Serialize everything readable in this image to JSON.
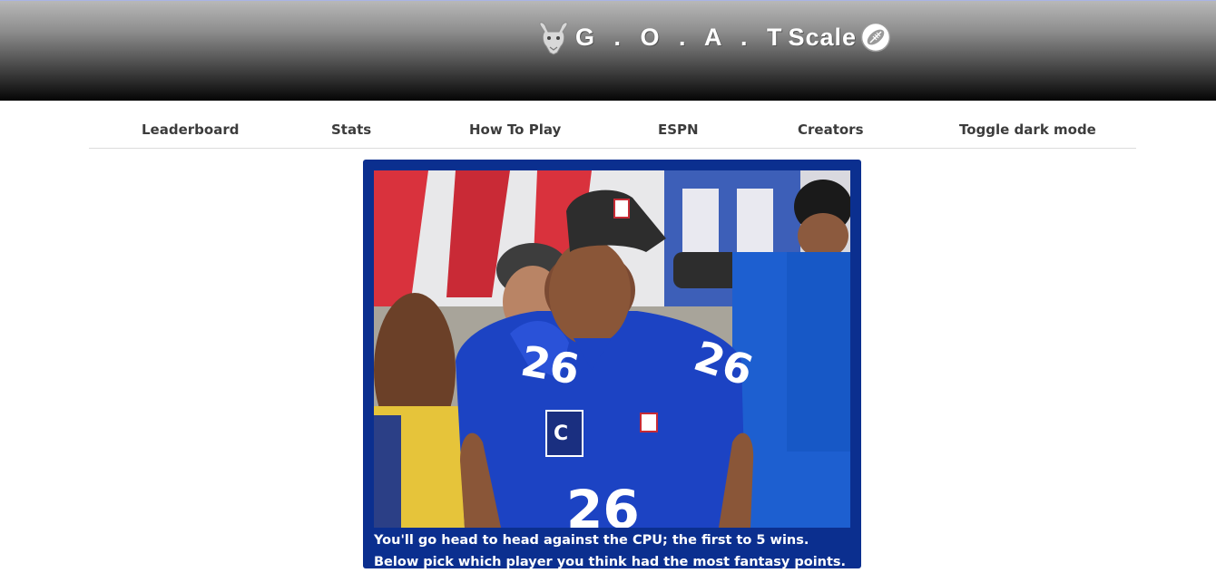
{
  "header": {
    "brand": {
      "title_part1": "G . O . A . T",
      "title_part2": "Scale",
      "logo_icon": "goat-head-icon",
      "badge_icon": "football-icon"
    }
  },
  "nav": {
    "items": [
      {
        "label": "Leaderboard"
      },
      {
        "label": "Stats"
      },
      {
        "label": "How To Play"
      },
      {
        "label": "ESPN"
      },
      {
        "label": "Creators"
      },
      {
        "label": "Toggle dark mode"
      }
    ]
  },
  "card": {
    "image_subject": "football player in blue #26 jersey",
    "caption": "You'll go head to head against the CPU; the first to 5 wins. Below pick which player you think had the most fantasy points."
  },
  "colors": {
    "card_bg": "#0b2f8f",
    "nav_text": "#3c3c3c",
    "header_top": "#b8b8b8",
    "header_bottom": "#050505"
  }
}
